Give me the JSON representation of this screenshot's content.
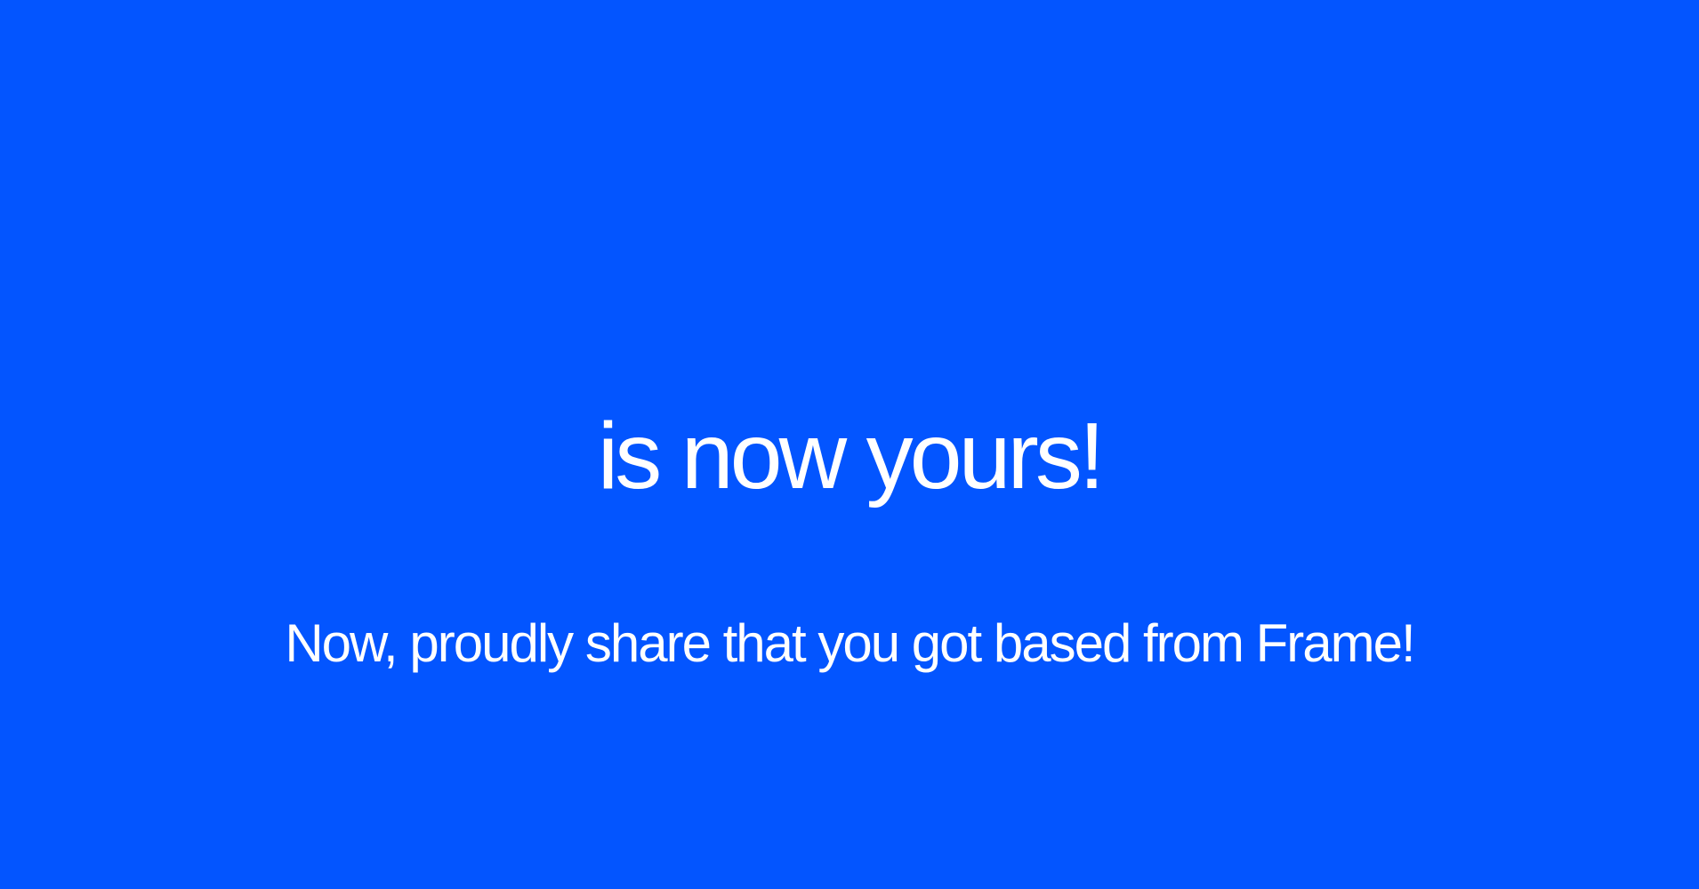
{
  "background_color": "#0355FF",
  "text_color": "#FFFFFF",
  "headline": "is now yours!",
  "subline": "Now, proudly share that you got based from Frame!"
}
